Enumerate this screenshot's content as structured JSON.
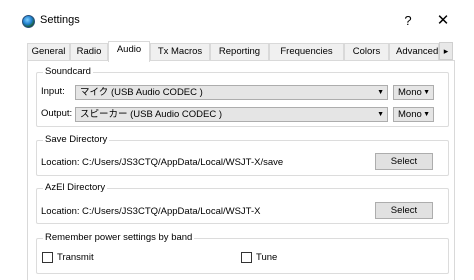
{
  "window": {
    "title": "Settings",
    "help_label": "?",
    "close_label": "✕"
  },
  "tabs": [
    {
      "label": "General"
    },
    {
      "label": "Radio"
    },
    {
      "label": "Audio"
    },
    {
      "label": "Tx Macros"
    },
    {
      "label": "Reporting"
    },
    {
      "label": "Frequencies"
    },
    {
      "label": "Colors"
    },
    {
      "label": "Advanced"
    }
  ],
  "active_tab": "Audio",
  "tab_scroll_label": "▸",
  "soundcard": {
    "title": "Soundcard",
    "input_label": "Input:",
    "input_value": "マイク (USB Audio CODEC )",
    "input_channel": "Mono",
    "output_label": "Output:",
    "output_value": "スピーカー (USB Audio CODEC )",
    "output_channel": "Mono"
  },
  "save_directory": {
    "title": "Save Directory",
    "location_label": "Location:",
    "path": "C:/Users/JS3CTQ/AppData/Local/WSJT-X/save",
    "select_label": "Select"
  },
  "azel_directory": {
    "title": "AzEl Directory",
    "location_label": "Location:",
    "path": "C:/Users/JS3CTQ/AppData/Local/WSJT-X",
    "select_label": "Select"
  },
  "power_settings": {
    "title": "Remember power settings by band",
    "transmit_label": "Transmit",
    "tune_label": "Tune"
  }
}
